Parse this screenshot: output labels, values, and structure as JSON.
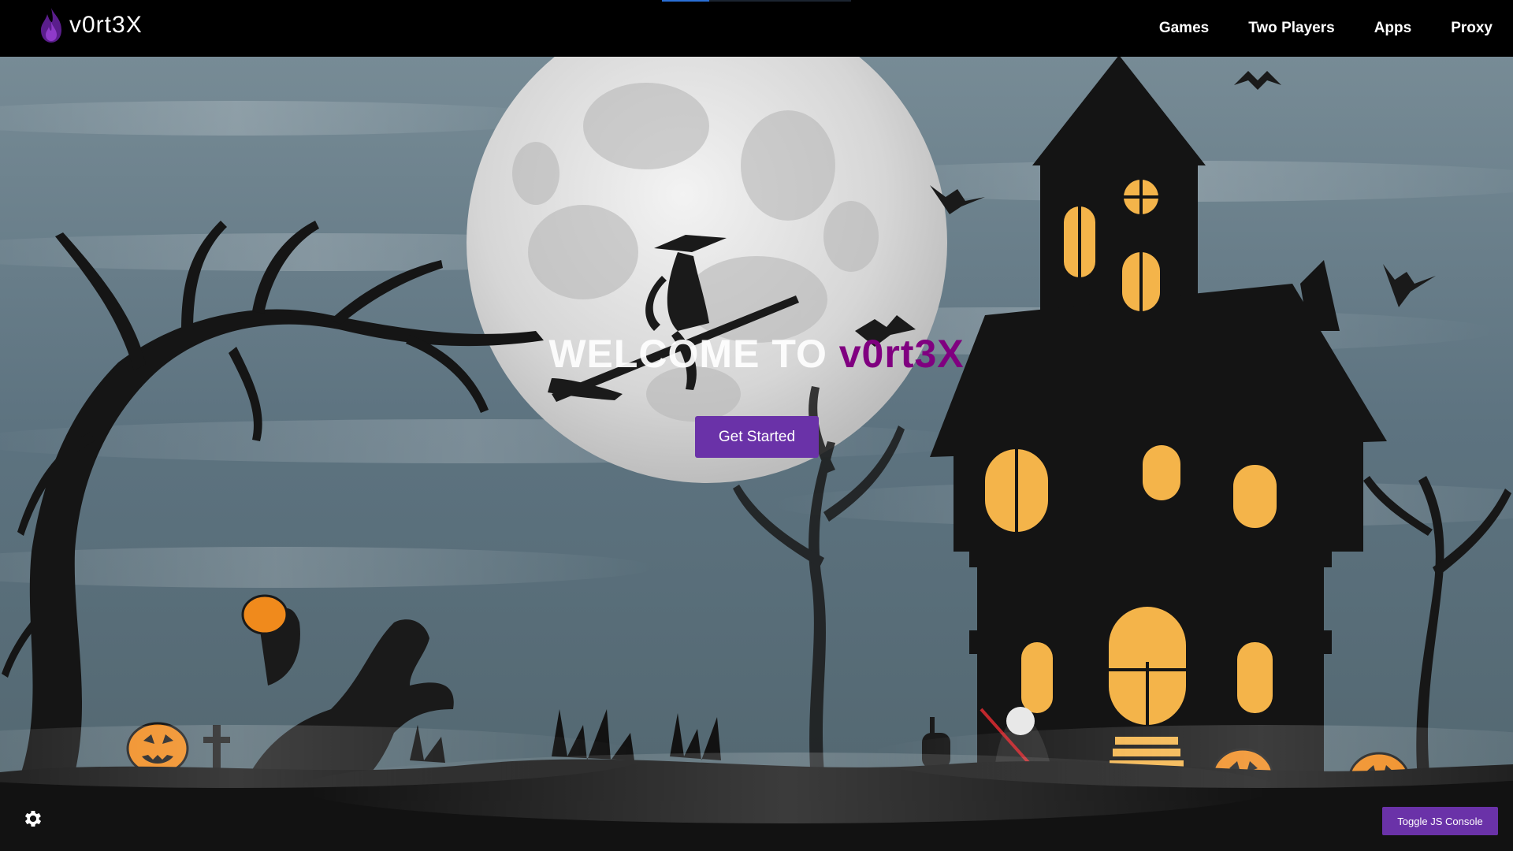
{
  "app": {
    "brand_name": "v0rt3X",
    "logo_icon": "purple-flame-icon",
    "accent_color": "#6a32a8",
    "brand_word_color": "#800080"
  },
  "nav": {
    "items": [
      {
        "label": "Games"
      },
      {
        "label": "Two Players"
      },
      {
        "label": "Apps"
      },
      {
        "label": "Proxy"
      }
    ],
    "loading_progress": 0.25
  },
  "hero": {
    "title_prefix": "WELCOME TO ",
    "title_brand": "v0rt3X",
    "cta_label": "Get Started"
  },
  "footer": {
    "settings_icon": "gear-icon",
    "console_button_label": "Toggle JS Console"
  },
  "background": {
    "theme": "halloween-haunted-night",
    "colors": {
      "sky": "#5d7380",
      "moon": "#e6e6e6",
      "silhouette": "#141414",
      "window_glow": "#f4b44a",
      "pumpkin": "#f08a1c"
    }
  }
}
